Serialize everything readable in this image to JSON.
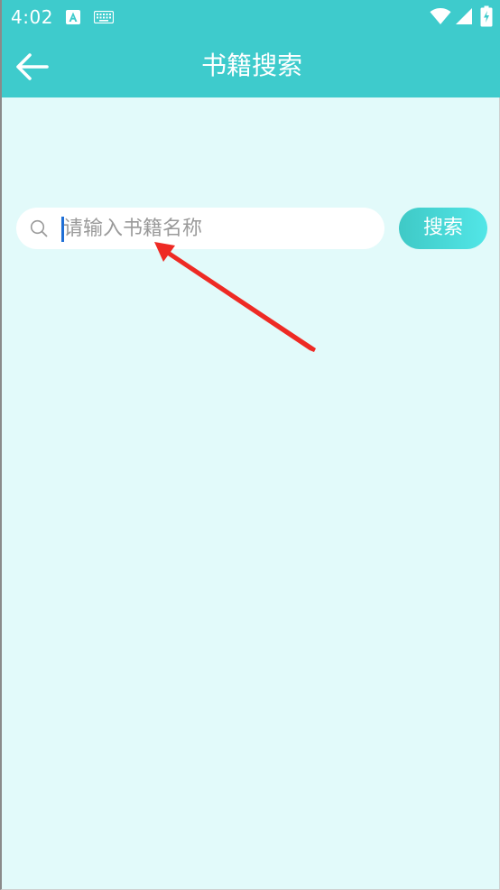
{
  "status_bar": {
    "time": "4:02",
    "icons": [
      "a-notification-icon",
      "keyboard-icon",
      "wifi-icon",
      "cell-signal-icon",
      "battery-charging-icon"
    ]
  },
  "app_bar": {
    "title": "书籍搜索",
    "back_icon": "arrow-left-icon"
  },
  "search": {
    "placeholder": "请输入书籍名称",
    "value": "",
    "button_label": "搜索",
    "icon": "search-icon"
  },
  "colors": {
    "header": "#3ecbcc",
    "background": "#e2fafa",
    "button_gradient_start": "#3fc9c6",
    "button_gradient_end": "#52e6e7",
    "annotation_arrow": "#ee2a24"
  }
}
